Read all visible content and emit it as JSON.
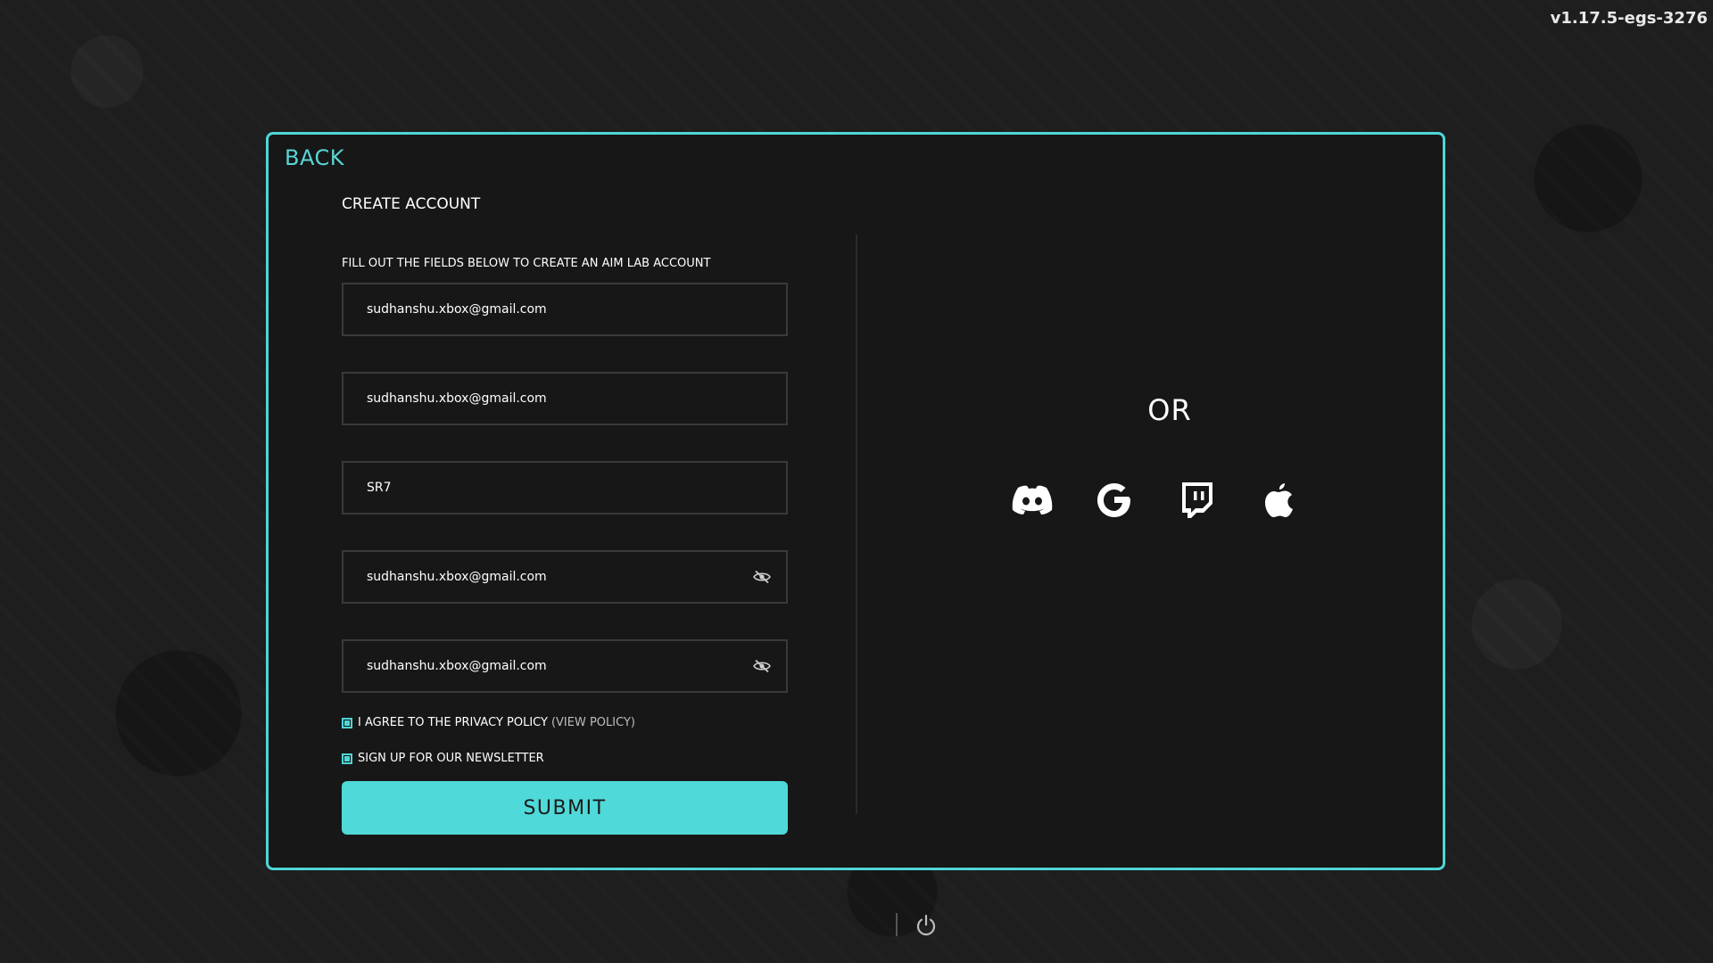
{
  "version": "v1.17.5-egs-3276",
  "panel": {
    "back_label": "BACK",
    "title": "CREATE ACCOUNT",
    "subtitle": "FILL OUT THE FIELDS BELOW TO CREATE AN AIM LAB ACCOUNT",
    "fields": [
      {
        "value": "sudhanshu.xbox@gmail.com"
      },
      {
        "value": "sudhanshu.xbox@gmail.com"
      },
      {
        "value": "SR7"
      },
      {
        "value": "sudhanshu.xbox@gmail.com",
        "icon": "eye-slash-icon"
      },
      {
        "value": "sudhanshu.xbox@gmail.com",
        "icon": "eye-slash-icon"
      }
    ],
    "privacy": {
      "label": "I AGREE TO THE PRIVACY POLICY",
      "link": "(VIEW POLICY)",
      "checked": true
    },
    "newsletter": {
      "label": "SIGN UP FOR OUR NEWSLETTER",
      "checked": true
    },
    "submit_label": "SUBMIT"
  },
  "social": {
    "or_label": "OR",
    "providers": [
      {
        "icon": "discord-icon"
      },
      {
        "icon": "google-icon"
      },
      {
        "icon": "twitch-icon"
      },
      {
        "icon": "apple-icon"
      }
    ]
  },
  "colors": {
    "accent": "#4fd6d6",
    "panel_bg": "#171717",
    "page_bg": "#1e1e1e"
  },
  "footer": {
    "icon": "power-icon"
  }
}
